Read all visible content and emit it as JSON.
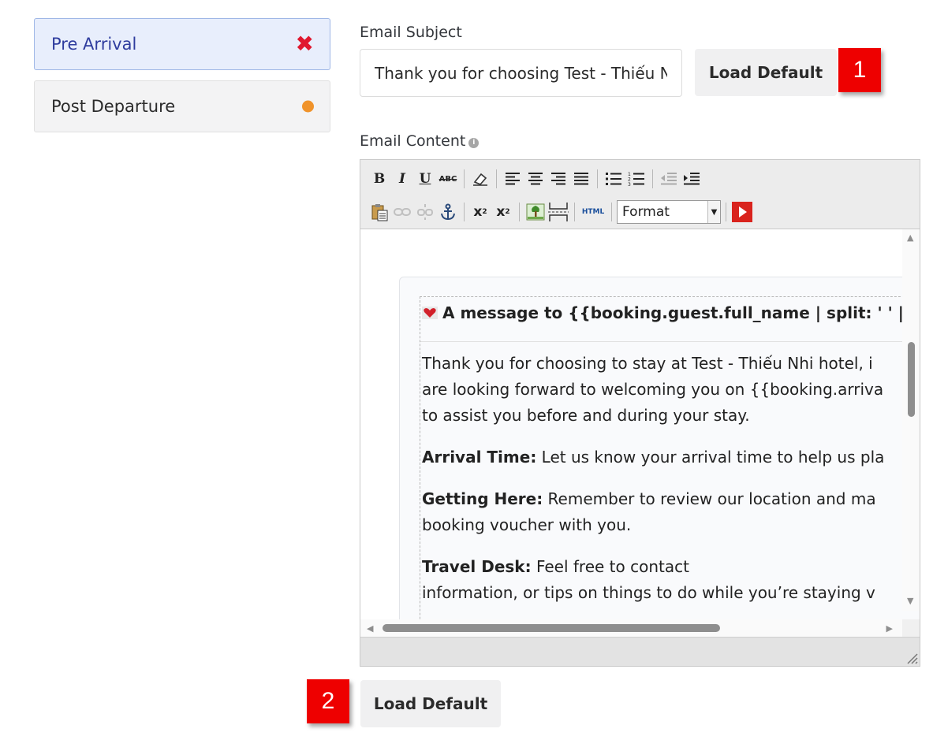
{
  "sidebar": {
    "items": [
      {
        "label": "Pre Arrival",
        "status_icon": "close-x-icon",
        "status_color": "#e0182f",
        "active": true
      },
      {
        "label": "Post Departure",
        "status_icon": "orange-dot-icon",
        "status_color": "#f0932b",
        "active": false
      }
    ]
  },
  "subject": {
    "label": "Email Subject",
    "value": "Thank you for choosing Test - Thiếu Nhi hotel"
  },
  "load_default_label": "Load Default",
  "badges": {
    "one": "1",
    "two": "2"
  },
  "content": {
    "label": "Email Content",
    "toolbar": {
      "format_value": "Format",
      "html_label": "HTML"
    },
    "body": {
      "heading": "A message to {{booking.guest.full_name | split: ' ' |",
      "p1_line1": "Thank you for choosing to stay at Test - Thiếu Nhi hotel, i",
      "p1_line2": "are looking forward to welcoming you on {{booking.arriva",
      "p1_line3": "to assist you before and during your stay.",
      "p2_bold": "Arrival Time:",
      "p2_text": " Let us know your arrival time to help us pla",
      "p3_bold": "Getting Here:",
      "p3_text": " Remember to review our location and ma",
      "p3_line2": "booking voucher with you.",
      "p4_bold": "Travel Desk:",
      "p4_text": " Feel free to contact",
      "p4_line2": "information, or tips on things to do while you’re staying v"
    }
  },
  "colors": {
    "accent": "#2e3c9e",
    "badge": "#ee0000"
  }
}
